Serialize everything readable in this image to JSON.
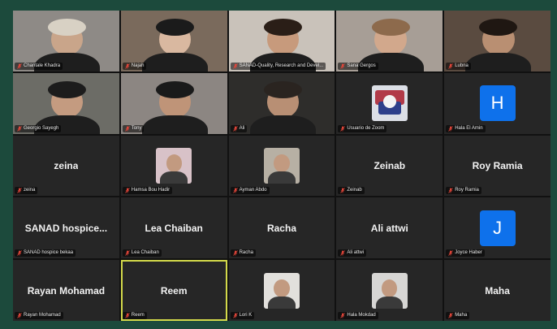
{
  "meeting": {
    "participants": [
      {
        "display_name": "Chantale Khadra",
        "big_label": "",
        "kind": "video",
        "bg": "#8e8a86",
        "skin": "#c9a58a",
        "hair": "#d8d1c4"
      },
      {
        "display_name": "Najah",
        "big_label": "",
        "kind": "video",
        "bg": "#7a6a5c",
        "skin": "#d9b8a0",
        "hair": "#1b1b1b"
      },
      {
        "display_name": "SANAD-Quality, Research and Devel...",
        "big_label": "",
        "kind": "video",
        "bg": "#c9c2ba",
        "skin": "#c79a7c",
        "hair": "#2a1e17"
      },
      {
        "display_name": "Sana Gergos",
        "big_label": "",
        "kind": "video",
        "bg": "#a79e96",
        "skin": "#d2a88c",
        "hair": "#8d6a4c"
      },
      {
        "display_name": "Lubna",
        "big_label": "",
        "kind": "video",
        "bg": "#5a4b40",
        "skin": "#b98f72",
        "hair": "#1f1712"
      },
      {
        "display_name": "Georgio Sayegh",
        "big_label": "",
        "kind": "video",
        "bg": "#6c6c66",
        "skin": "#c49b80",
        "hair": "#1c1c1c"
      },
      {
        "display_name": "Tony",
        "big_label": "",
        "kind": "video",
        "bg": "#8c8682",
        "skin": "#bf9478",
        "hair": "#1a1a1a"
      },
      {
        "display_name": "Ali",
        "big_label": "",
        "kind": "video",
        "bg": "#2e2d2b",
        "skin": "#b88f74",
        "hair": "#2a2420"
      },
      {
        "display_name": "Usuario de Zoom",
        "big_label": "",
        "kind": "image",
        "bg": "#262626"
      },
      {
        "display_name": "Hala El Amin",
        "big_label": "",
        "kind": "letter",
        "letter": "H"
      },
      {
        "display_name": "zeina",
        "big_label": "zeina",
        "kind": "name"
      },
      {
        "display_name": "Hamsa Bou Hadir",
        "big_label": "",
        "kind": "photo",
        "bg": "#d8c2c8"
      },
      {
        "display_name": "Ayman Abdo",
        "big_label": "",
        "kind": "photo",
        "bg": "#b7b0a4"
      },
      {
        "display_name": "Zeinab",
        "big_label": "Zeinab",
        "kind": "name"
      },
      {
        "display_name": "Roy Ramia",
        "big_label": "Roy Ramia",
        "kind": "name"
      },
      {
        "display_name": "SANAD hospice bekaa",
        "big_label": "SANAD  hospice...",
        "kind": "name"
      },
      {
        "display_name": "Lea Chaiban",
        "big_label": "Lea Chaiban",
        "kind": "name"
      },
      {
        "display_name": "Racha",
        "big_label": "Racha",
        "kind": "name"
      },
      {
        "display_name": "Ali attwi",
        "big_label": "Ali attwi",
        "kind": "name"
      },
      {
        "display_name": "Joyce Haber",
        "big_label": "",
        "kind": "letter",
        "letter": "J"
      },
      {
        "display_name": "Rayan Mohamad",
        "big_label": "Rayan Mohamad",
        "kind": "name"
      },
      {
        "display_name": "Reem",
        "big_label": "Reem",
        "kind": "name",
        "active": true
      },
      {
        "display_name": "Lori K",
        "big_label": "",
        "kind": "photo",
        "bg": "#e2e0dc"
      },
      {
        "display_name": "Hala Mokdad",
        "big_label": "",
        "kind": "photo",
        "bg": "#d7d6d4"
      },
      {
        "display_name": "Maha",
        "big_label": "Maha",
        "kind": "name"
      }
    ]
  },
  "colors": {
    "frame": "#1c4a3c",
    "tile": "#262626",
    "active_border": "#d3d94a",
    "avatar_blue": "#0e71eb",
    "mic_muted": "#e5463a"
  },
  "icons": {
    "mic": "muted-mic-icon"
  }
}
